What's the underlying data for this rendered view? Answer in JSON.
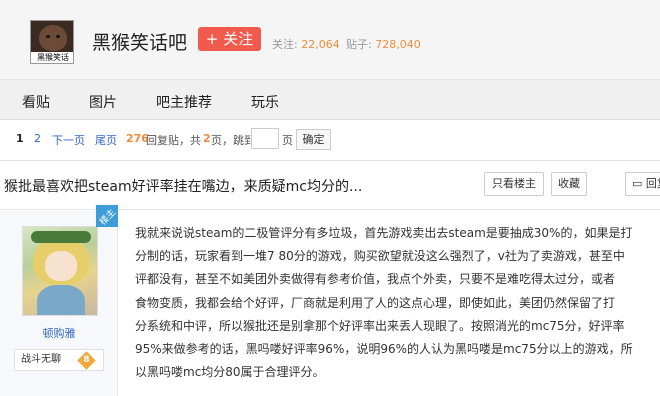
{
  "forum": {
    "avatar_caption": "黑猴笑话",
    "name": "黑猴笑话吧",
    "follow_label": "+ 关注",
    "follow_count_label": "关注:",
    "follow_count": "22,064",
    "post_count_label": "贴子:",
    "post_count": "728,040"
  },
  "nav": {
    "tabs": [
      "看贴",
      "图片",
      "吧主推荐",
      "玩乐"
    ]
  },
  "pager": {
    "page1": "1",
    "page2": "2",
    "next": "下一页",
    "last": "尾页",
    "reply_count": "276",
    "reply_label": "回复贴，共",
    "page_total": "2",
    "page_total_suffix": "页，跳到",
    "page_unit": "页",
    "confirm": "确定"
  },
  "thread": {
    "title": "猴批最喜欢把steam好评率挂在嘴边，来质疑mc均分的...",
    "only_op": "只看楼主",
    "favorite": "收藏",
    "reply": "回复"
  },
  "author": {
    "name": "顿购雅",
    "badge": "战斗无聊",
    "level": "8",
    "corner": "楼主"
  },
  "post": {
    "lines": [
      "我就来说说steam的二极管评分有多垃圾，首先游戏卖出去steam是要抽成30%的，如果是打",
      "分制的话，玩家看到一堆7 80分的游戏，购买欲望就没这么强烈了，v社为了卖游戏，甚至中",
      "评都没有，甚至不如美团外卖做得有参考价值，我点个外卖，只要不是难吃得太过分，或者",
      "食物变质，我都会给个好评，厂商就是利用了人的这点心理，即使如此，美团仍然保留了打",
      "分系统和中评，所以猴批还是别拿那个好评率出来丢人现眼了。按照消光的mc75分，好评率",
      "95%来做参考的话，黑吗喽好评率96%，说明96%的人认为黑吗喽是mc75分以上的游戏，所",
      "以黑吗喽mc均分80属于合理评分。"
    ]
  }
}
